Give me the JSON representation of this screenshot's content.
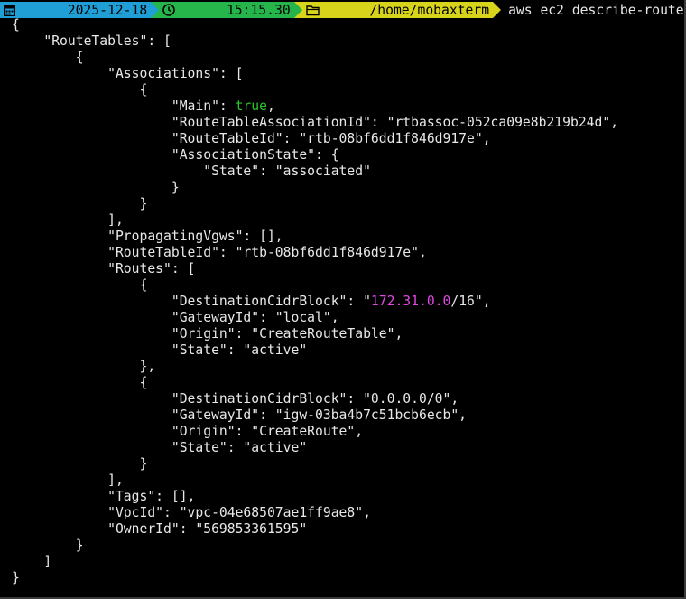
{
  "prompt": {
    "date": "2025-12-18",
    "time": "15:15.30",
    "path": "/home/mobaxterm",
    "command": "aws ec2 describe-route-tables",
    "icons": [
      "calendar-icon",
      "clock-icon",
      "folder-icon"
    ],
    "colors": {
      "date_bg": "#1f9fd6",
      "time_bg": "#26b54a",
      "path_bg": "#d8d41c"
    }
  },
  "output": {
    "lines": [
      "{",
      "    \"RouteTables\": [",
      "        {",
      "            \"Associations\": [",
      "                {",
      "                    \"Main\": true,",
      "                    \"RouteTableAssociationId\": \"rtbassoc-052ca09e8b219b24d\",",
      "                    \"RouteTableId\": \"rtb-08bf6dd1f846d917e\",",
      "                    \"AssociationState\": {",
      "                        \"State\": \"associated\"",
      "                    }",
      "                }",
      "            ],",
      "            \"PropagatingVgws\": [],",
      "            \"RouteTableId\": \"rtb-08bf6dd1f846d917e\",",
      "            \"Routes\": [",
      "                {",
      "                    \"DestinationCidrBlock\": \"172.31.0.0/16\",",
      "                    \"GatewayId\": \"local\",",
      "                    \"Origin\": \"CreateRouteTable\",",
      "                    \"State\": \"active\"",
      "                },",
      "                {",
      "                    \"DestinationCidrBlock\": \"0.0.0.0/0\",",
      "                    \"GatewayId\": \"igw-03ba4b7c51bcb6ecb\",",
      "                    \"Origin\": \"CreateRoute\",",
      "                    \"State\": \"active\"",
      "                }",
      "            ],",
      "            \"Tags\": [],",
      "            \"VpcId\": \"vpc-04e68507ae1ff9ae8\",",
      "            \"OwnerId\": \"569853361595\"",
      "        }",
      "    ]",
      "}"
    ],
    "highlight_colors": {
      "boolean": "#29c729",
      "ip_address": "#e048e0"
    }
  }
}
